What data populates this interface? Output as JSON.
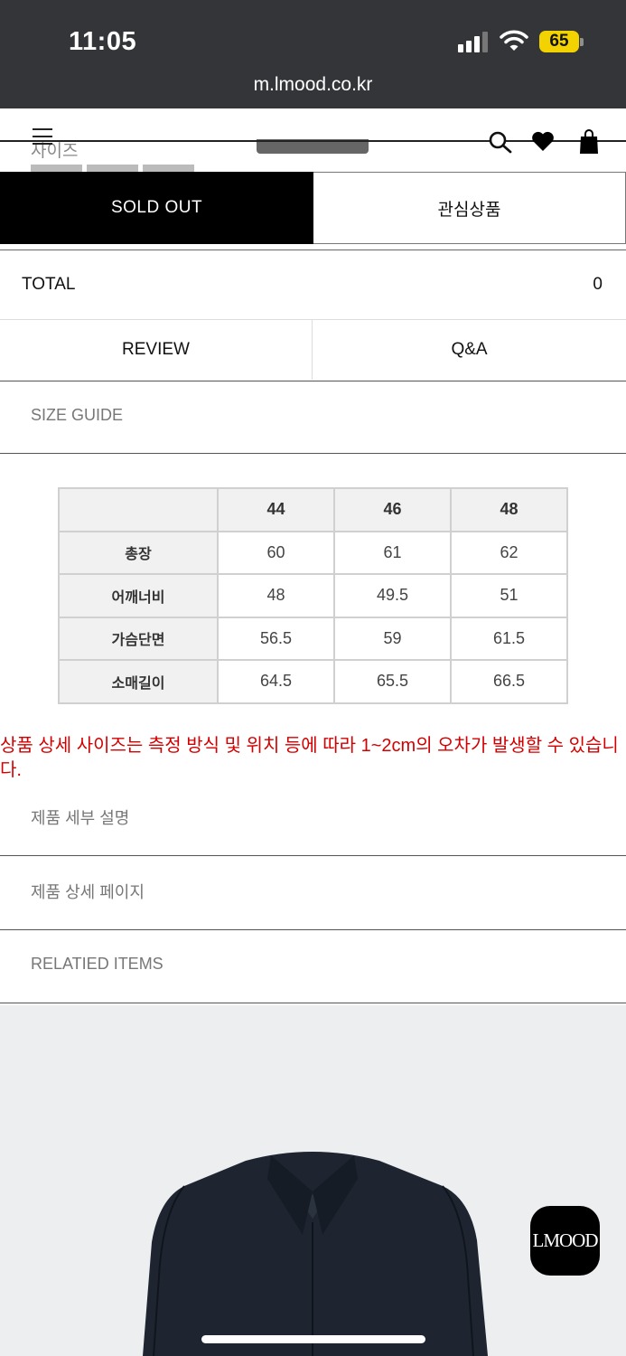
{
  "status_bar": {
    "time": "11:05",
    "battery": "65",
    "url": "m.lmood.co.kr"
  },
  "header": {
    "under_label": "사이즈"
  },
  "actions": {
    "sold_out": "SOLD OUT",
    "wishlist": "관심상품"
  },
  "total": {
    "label": "TOTAL",
    "value": "0"
  },
  "tabs": {
    "review": "REVIEW",
    "qa": "Q&A"
  },
  "sections": {
    "size_guide": "SIZE GUIDE",
    "product_details": "제품 세부 설명",
    "product_page": "제품 상세 페이지",
    "related_items": "RELATIED ITEMS"
  },
  "size_table": {
    "columns": [
      "44",
      "46",
      "48"
    ],
    "rows": [
      {
        "label": "총장",
        "values": [
          "60",
          "61",
          "62"
        ]
      },
      {
        "label": "어깨너비",
        "values": [
          "48",
          "49.5",
          "51"
        ]
      },
      {
        "label": "가슴단면",
        "values": [
          "56.5",
          "59",
          "61.5"
        ]
      },
      {
        "label": "소매길이",
        "values": [
          "64.5",
          "65.5",
          "66.5"
        ]
      }
    ]
  },
  "notice": "상품 상세 사이즈는 측정 방식 및 위치 등에 따라 1~2cm의 오차가 발생할 수 있습니다.",
  "badge": "LMOOD"
}
